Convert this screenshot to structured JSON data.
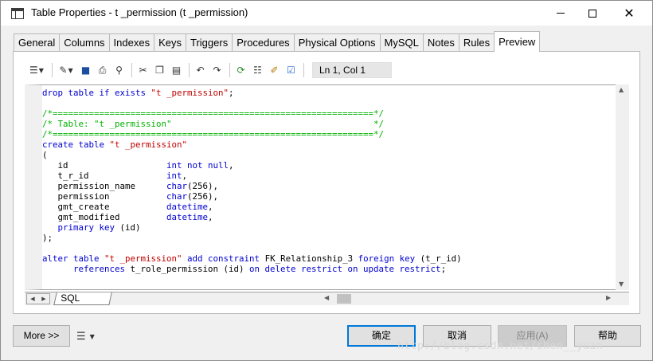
{
  "window": {
    "title": "Table Properties - t _permission (t _permission)"
  },
  "tabs": [
    {
      "label": "General"
    },
    {
      "label": "Columns"
    },
    {
      "label": "Indexes"
    },
    {
      "label": "Keys"
    },
    {
      "label": "Triggers"
    },
    {
      "label": "Procedures"
    },
    {
      "label": "Physical Options"
    },
    {
      "label": "MySQL"
    },
    {
      "label": "Notes"
    },
    {
      "label": "Rules"
    },
    {
      "label": "Preview"
    }
  ],
  "active_tab": "Preview",
  "toolbar": {
    "cursor_position": "Ln 1, Col 1",
    "icons": [
      "edit-dropdown-icon",
      "properties-dropdown-icon",
      "save-icon",
      "print-icon",
      "find-icon",
      "cut-icon",
      "copy-icon",
      "paste-icon",
      "undo-icon",
      "redo-icon",
      "refresh-icon",
      "list-icon",
      "edit-icon",
      "check-icon"
    ]
  },
  "editor": {
    "lines": [
      [
        {
          "t": "kw",
          "v": "drop table if exists "
        },
        {
          "t": "str",
          "v": "\"t _permission\""
        },
        {
          "t": "plain",
          "v": ";"
        }
      ],
      [],
      [
        {
          "t": "cm",
          "v": "/*==============================================================*/"
        }
      ],
      [
        {
          "t": "cm",
          "v": "/* Table: \"t _permission\"                                       */"
        }
      ],
      [
        {
          "t": "cm",
          "v": "/*==============================================================*/"
        }
      ],
      [
        {
          "t": "kw",
          "v": "create table "
        },
        {
          "t": "str",
          "v": "\"t _permission\""
        }
      ],
      [
        {
          "t": "plain",
          "v": "("
        }
      ],
      [
        {
          "t": "plain",
          "v": "   id                   "
        },
        {
          "t": "kw",
          "v": "int not null"
        },
        {
          "t": "plain",
          "v": ","
        }
      ],
      [
        {
          "t": "plain",
          "v": "   t_r_id               "
        },
        {
          "t": "kw",
          "v": "int"
        },
        {
          "t": "plain",
          "v": ","
        }
      ],
      [
        {
          "t": "plain",
          "v": "   permission_name      "
        },
        {
          "t": "kw",
          "v": "char"
        },
        {
          "t": "plain",
          "v": "(256),"
        }
      ],
      [
        {
          "t": "plain",
          "v": "   permission           "
        },
        {
          "t": "kw",
          "v": "char"
        },
        {
          "t": "plain",
          "v": "(256),"
        }
      ],
      [
        {
          "t": "plain",
          "v": "   gmt_create           "
        },
        {
          "t": "kw",
          "v": "datetime"
        },
        {
          "t": "plain",
          "v": ","
        }
      ],
      [
        {
          "t": "plain",
          "v": "   gmt_modified         "
        },
        {
          "t": "kw",
          "v": "datetime"
        },
        {
          "t": "plain",
          "v": ","
        }
      ],
      [
        {
          "t": "plain",
          "v": "   "
        },
        {
          "t": "kw",
          "v": "primary key"
        },
        {
          "t": "plain",
          "v": " (id)"
        }
      ],
      [
        {
          "t": "plain",
          "v": ");"
        }
      ],
      [],
      [
        {
          "t": "kw",
          "v": "alter table "
        },
        {
          "t": "str",
          "v": "\"t _permission\""
        },
        {
          "t": "plain",
          "v": " "
        },
        {
          "t": "kw",
          "v": "add constraint"
        },
        {
          "t": "plain",
          "v": " FK_Relationship_3 "
        },
        {
          "t": "kw",
          "v": "foreign key"
        },
        {
          "t": "plain",
          "v": " (t_r_id)"
        }
      ],
      [
        {
          "t": "plain",
          "v": "      "
        },
        {
          "t": "kw",
          "v": "references"
        },
        {
          "t": "plain",
          "v": " t_role_permission (id) "
        },
        {
          "t": "kw",
          "v": "on delete restrict on update restrict"
        },
        {
          "t": "plain",
          "v": ";"
        }
      ]
    ]
  },
  "sheet_tab": {
    "label": "SQL"
  },
  "footer": {
    "more_label": "More >>",
    "ok_label": "确定",
    "cancel_label": "取消",
    "apply_label": "应用(A)",
    "help_label": "帮助"
  },
  "watermark": "http://blog.csdn.net/chen__yuan"
}
